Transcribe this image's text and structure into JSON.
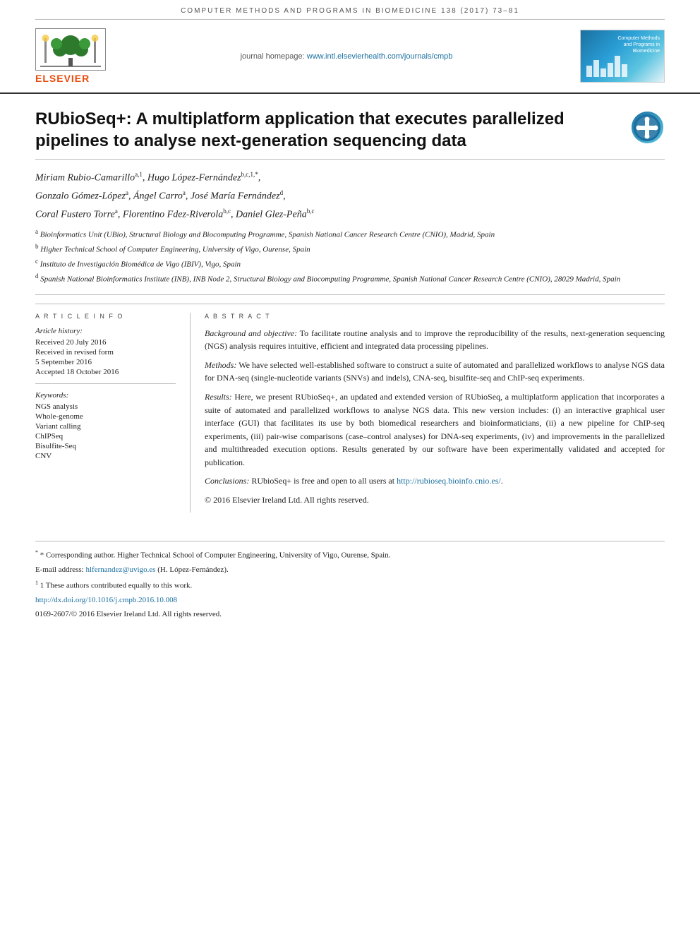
{
  "page": {
    "journal_header": "COMPUTER METHODS AND PROGRAMS IN BIOMEDICINE 138 (2017) 73–81",
    "elsevier_brand": "ELSEVIER",
    "journal_homepage_label": "journal homepage:",
    "journal_homepage_url": "www.intl.elsevierhealth.com/journals/cmpb",
    "article_title": "RUbioSeq+: A multiplatform application that executes parallelized pipelines to analyse next-generation sequencing data",
    "crossmark_label": "CrossMark",
    "authors": [
      {
        "name": "Miriam Rubio-Camarillo",
        "sup": "a,1"
      },
      {
        "name": "Hugo López-Fernández",
        "sup": "b,c,1,*"
      },
      {
        "name": "Gonzalo Gómez-López",
        "sup": "a"
      },
      {
        "name": "Ángel Carro",
        "sup": "a"
      },
      {
        "name": "José María Fernández",
        "sup": "d"
      },
      {
        "name": "Coral Fustero Torre",
        "sup": "a"
      },
      {
        "name": "Florentino Fdez-Riverola",
        "sup": "b,c"
      },
      {
        "name": "Daniel Glez-Peña",
        "sup": "b,c"
      }
    ],
    "affiliations": [
      {
        "sup": "a",
        "text": "Bioinformatics Unit (UBio), Structural Biology and Biocomputing Programme, Spanish National Cancer Research Centre (CNIO), Madrid, Spain"
      },
      {
        "sup": "b",
        "text": "Higher Technical School of Computer Engineering, University of Vigo, Ourense, Spain"
      },
      {
        "sup": "c",
        "text": "Instituto de Investigación Biomédica de Vigo (IBIV), Vigo, Spain"
      },
      {
        "sup": "d",
        "text": "Spanish National Bioinformatics Institute (INB), INB Node 2, Structural Biology and Biocomputing Programme, Spanish National Cancer Research Centre (CNIO), 28029 Madrid, Spain"
      }
    ],
    "article_info_label": "A R T I C L E   I N F O",
    "article_history_label": "Article history:",
    "received_label": "Received 20 July 2016",
    "received_revised_label": "Received in revised form",
    "received_revised_date": "5 September 2016",
    "accepted_label": "Accepted 18 October 2016",
    "keywords_label": "Keywords:",
    "keywords": [
      "NGS analysis",
      "Whole-genome",
      "Variant calling",
      "ChIPSeq",
      "Bisulfite-Seq",
      "CNV"
    ],
    "abstract_label": "A B S T R A C T",
    "abstract": {
      "background": {
        "label": "Background and objective:",
        "text": " To facilitate routine analysis and to improve the reproducibility of the results, next-generation sequencing (NGS) analysis requires intuitive, efficient and integrated data processing pipelines."
      },
      "methods": {
        "label": "Methods:",
        "text": " We have selected well-established software to construct a suite of automated and parallelized workflows to analyse NGS data for DNA-seq (single-nucleotide variants (SNVs) and indels), CNA-seq, bisulfite-seq and ChIP-seq experiments."
      },
      "results": {
        "label": "Results:",
        "text": " Here, we present RUbioSeq+, an updated and extended version of RUbioSeq, a multiplatform application that incorporates a suite of automated and parallelized workflows to analyse NGS data. This new version includes: (i) an interactive graphical user interface (GUI) that facilitates its use by both biomedical researchers and bioinformaticians, (ii) a new pipeline for ChIP-seq experiments, (iii) pair-wise comparisons (case–control analyses) for DNA-seq experiments, (iv) and improvements in the parallelized and multithreaded execution options. Results generated by our software have been experimentally validated and accepted for publication."
      },
      "conclusions": {
        "label": "Conclusions:",
        "text": " RUbioSeq+ is free and open to all users at "
      },
      "url": "http://rubioseq.bioinfo.cnio.es/",
      "copyright": "© 2016 Elsevier Ireland Ltd. All rights reserved."
    },
    "footer": {
      "corresponding_author": "* Corresponding author. Higher Technical School of Computer Engineering, University of Vigo, Ourense, Spain.",
      "email_label": "E-mail address:",
      "email": "hlfernandez@uvigo.es",
      "email_note": "(H. López-Fernández).",
      "equal_contribution": "1 These authors contributed equally to this work.",
      "doi": "http://dx.doi.org/10.1016/j.cmpb.2016.10.008",
      "issn": "0169-2607/© 2016 Elsevier Ireland Ltd. All rights reserved."
    }
  }
}
